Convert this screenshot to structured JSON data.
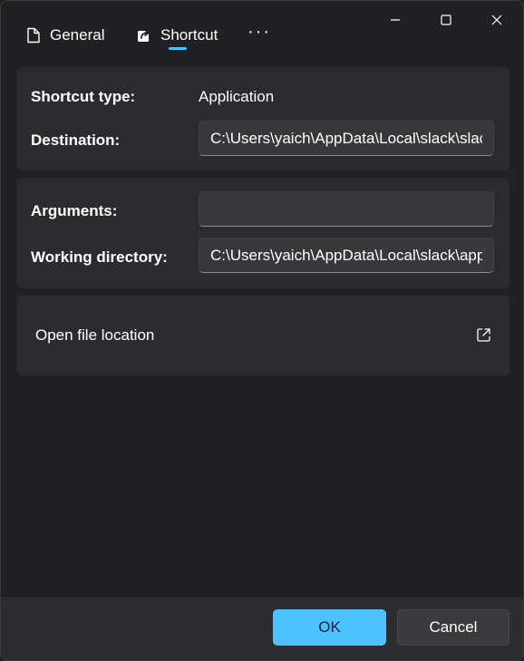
{
  "tabs": [
    {
      "label": "General",
      "icon": "document-icon",
      "selected": false
    },
    {
      "label": "Shortcut",
      "icon": "shortcut-arrow-icon",
      "selected": true
    }
  ],
  "more_label": "···",
  "colors": {
    "accent": "#4cc2ff",
    "background": "#202124",
    "card": "#2b2c2f"
  },
  "shortcut": {
    "type_label": "Shortcut type:",
    "type_value": "Application",
    "destination_label": "Destination:",
    "destination_value": "C:\\Users\\yaich\\AppData\\Local\\slack\\slack.exe"
  },
  "args": {
    "arguments_label": "Arguments:",
    "arguments_value": "",
    "working_dir_label": "Working directory:",
    "working_dir_value": "C:\\Users\\yaich\\AppData\\Local\\slack\\app"
  },
  "open_location": {
    "label": "Open file location",
    "icon": "open-external-icon"
  },
  "footer": {
    "ok_label": "OK",
    "cancel_label": "Cancel"
  }
}
